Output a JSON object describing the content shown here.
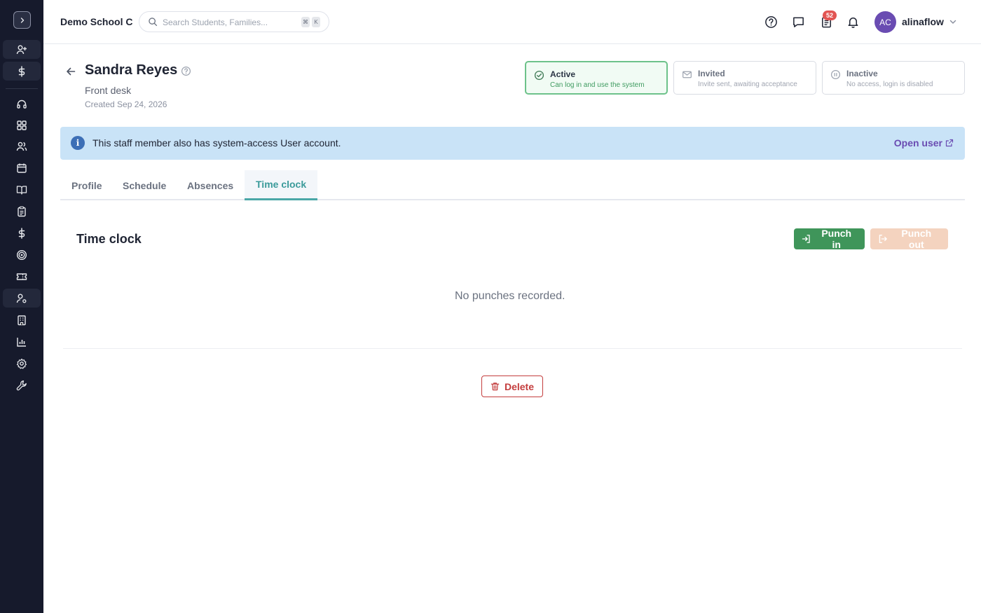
{
  "app": {
    "school_name": "Demo School C"
  },
  "search": {
    "placeholder": "Search Students, Families...",
    "shortcut_mod": "⌘",
    "shortcut_key": "K"
  },
  "topbar": {
    "notification_count": "52",
    "user_initials": "AC",
    "username": "alinaflow"
  },
  "sidebar": {
    "items": [
      {
        "icon": "user-plus-icon"
      },
      {
        "icon": "dollar-icon"
      },
      {
        "icon": "headset-icon"
      },
      {
        "icon": "grid-icon"
      },
      {
        "icon": "users-icon"
      },
      {
        "icon": "calendar-icon"
      },
      {
        "icon": "book-icon"
      },
      {
        "icon": "clipboard-icon"
      },
      {
        "icon": "dollar-icon"
      },
      {
        "icon": "target-icon"
      },
      {
        "icon": "ticket-icon"
      },
      {
        "icon": "user-settings-icon"
      },
      {
        "icon": "building-icon"
      },
      {
        "icon": "bar-chart-icon"
      },
      {
        "icon": "gear-icon"
      },
      {
        "icon": "wrench-icon"
      }
    ]
  },
  "staff": {
    "name": "Sandra Reyes",
    "role": "Front desk",
    "created": "Created Sep 24, 2026"
  },
  "status_options": [
    {
      "title": "Active",
      "description": "Can log in and use the system",
      "selected": true
    },
    {
      "title": "Invited",
      "description": "Invite sent, awaiting acceptance",
      "selected": false
    },
    {
      "title": "Inactive",
      "description": "No access, login is disabled",
      "selected": false
    }
  ],
  "banner": {
    "text": "This staff member also has system-access User account.",
    "link_label": "Open user"
  },
  "tabs": [
    {
      "label": "Profile",
      "active": false
    },
    {
      "label": "Schedule",
      "active": false
    },
    {
      "label": "Absences",
      "active": false
    },
    {
      "label": "Time clock",
      "active": true
    }
  ],
  "time_clock": {
    "title": "Time clock",
    "punch_in_label": "Punch in",
    "punch_out_label": "Punch out",
    "empty_message": "No punches recorded."
  },
  "actions": {
    "delete_label": "Delete"
  },
  "colors": {
    "sidebar_bg": "#161a2c",
    "accent_teal": "#3a9a9a",
    "punch_in_green": "#3f955a",
    "punch_out_disabled": "#f4d3bf",
    "danger": "#c43d3d",
    "banner_bg": "#c9e3f7",
    "link_purple": "#6a4cb2"
  }
}
